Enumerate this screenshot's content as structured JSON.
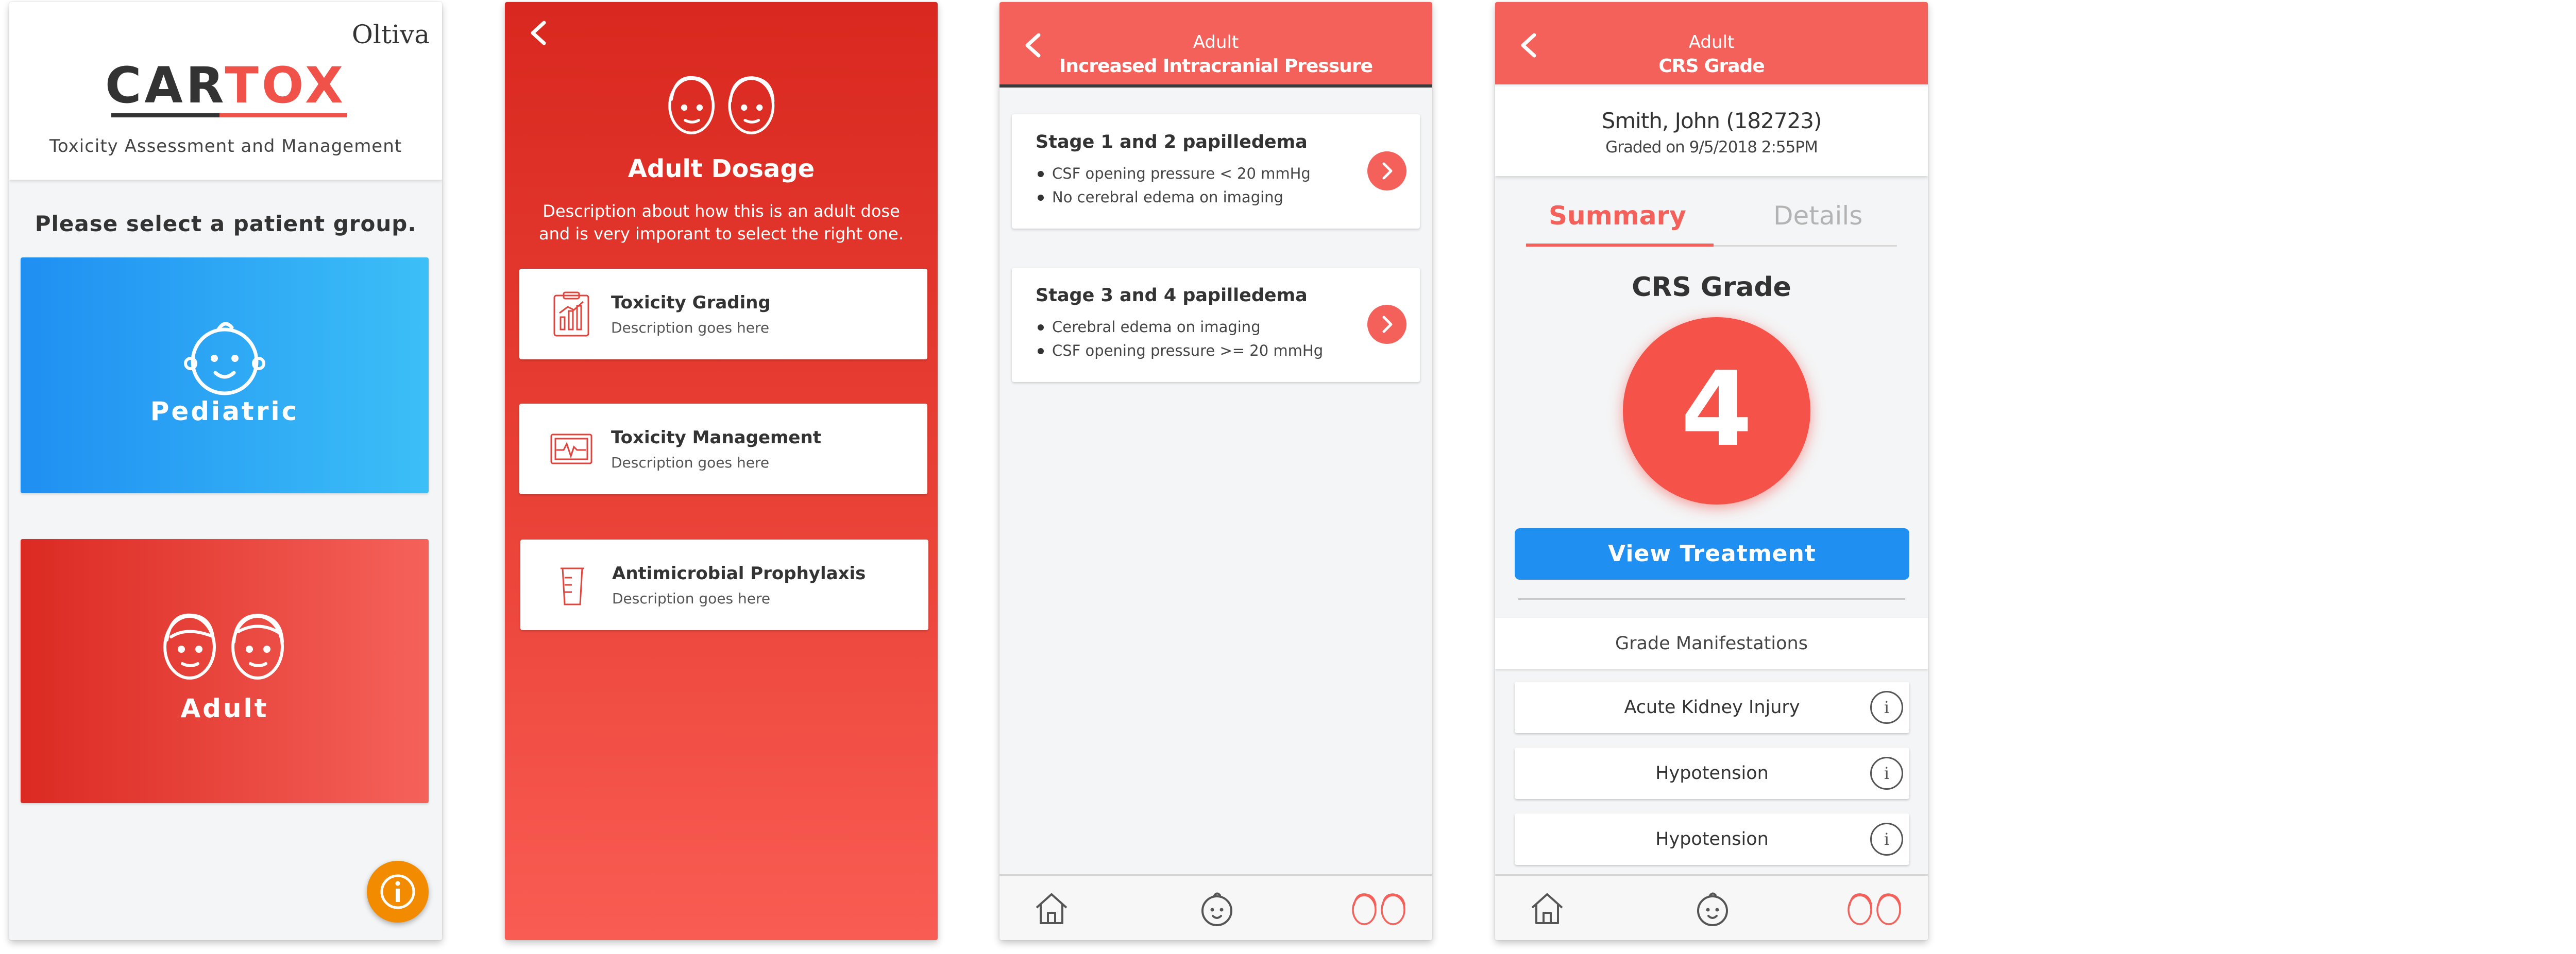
{
  "screen1": {
    "brand": "Oltiva",
    "logo_part1": "CAR",
    "logo_part2": "TOX",
    "tagline": "Toxicity Assessment and Management",
    "prompt": "Please select a patient group.",
    "pediatric_label": "Pediatric",
    "adult_label": "Adult",
    "info_icon": "info-icon"
  },
  "screen2": {
    "title": "Adult Dosage",
    "description": "Description about how this is an adult dose and is very imporant to select the right one.",
    "menu": [
      {
        "title": "Toxicity Grading",
        "desc": "Description goes here",
        "icon": "clipboard-chart-icon"
      },
      {
        "title": "Toxicity Management",
        "desc": "Description goes here",
        "icon": "monitor-pulse-icon"
      },
      {
        "title": "Antimicrobial Prophylaxis",
        "desc": "Description goes here",
        "icon": "medicine-cup-icon"
      }
    ]
  },
  "screen3": {
    "subtitle": "Adult",
    "title": "Increased Intracranial Pressure",
    "stages": [
      {
        "title": "Stage 1 and 2 papilledema",
        "bullets": [
          "CSF opening pressure < 20 mmHg",
          "No cerebral edema on imaging"
        ]
      },
      {
        "title": "Stage 3 and 4 papilledema",
        "bullets": [
          "Cerebral edema on imaging",
          "CSF opening pressure >= 20 mmHg"
        ]
      }
    ]
  },
  "screen4": {
    "subtitle": "Adult",
    "title": "CRS Grade",
    "patient_name": "Smith, John (182723)",
    "graded_on": "Graded on 9/5/2018 2:55PM",
    "tabs": [
      "Summary",
      "Details"
    ],
    "active_tab": "Summary",
    "grade_label": "CRS Grade",
    "grade_value": "4",
    "view_button": "View Treatment",
    "manifestations_header": "Grade Manifestations",
    "manifestations": [
      "Acute Kidney Injury",
      "Hypotension",
      "Hypotension"
    ],
    "info_glyph": "i"
  },
  "colors": {
    "red_accent": "#f4605a",
    "blue_accent": "#1f8ff2",
    "orange_fab": "#f28b00",
    "dark_text": "#333333"
  }
}
